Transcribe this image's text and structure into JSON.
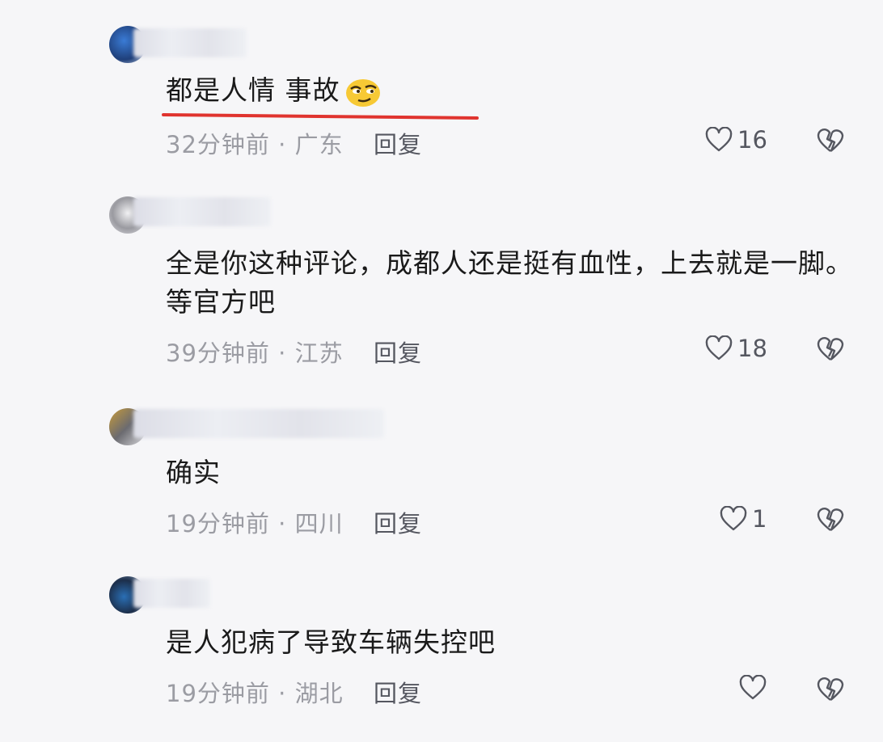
{
  "comments": [
    {
      "text": "都是人情 事故",
      "time": "32分钟前",
      "location": "广东",
      "reply_label": "回复",
      "likes": "16",
      "emoji": "smirk-emoji"
    },
    {
      "text": "全是你这种评论，成都人还是挺有血性，上去就是一脚。等官方吧",
      "time": "39分钟前",
      "location": "江苏",
      "reply_label": "回复",
      "likes": "18"
    },
    {
      "text": "确实",
      "time": "19分钟前",
      "location": "四川",
      "reply_label": "回复",
      "likes": "1"
    },
    {
      "text": "是人犯病了导致车辆失控吧",
      "time": "19分钟前",
      "location": "湖北",
      "reply_label": "回复",
      "likes": ""
    }
  ],
  "separator": " · ",
  "colors": {
    "underline": "#e0342f",
    "meta": "#9b9ca3",
    "action": "#555760"
  },
  "icons": {
    "like": "heart-outline-icon",
    "dislike": "broken-heart-icon"
  }
}
